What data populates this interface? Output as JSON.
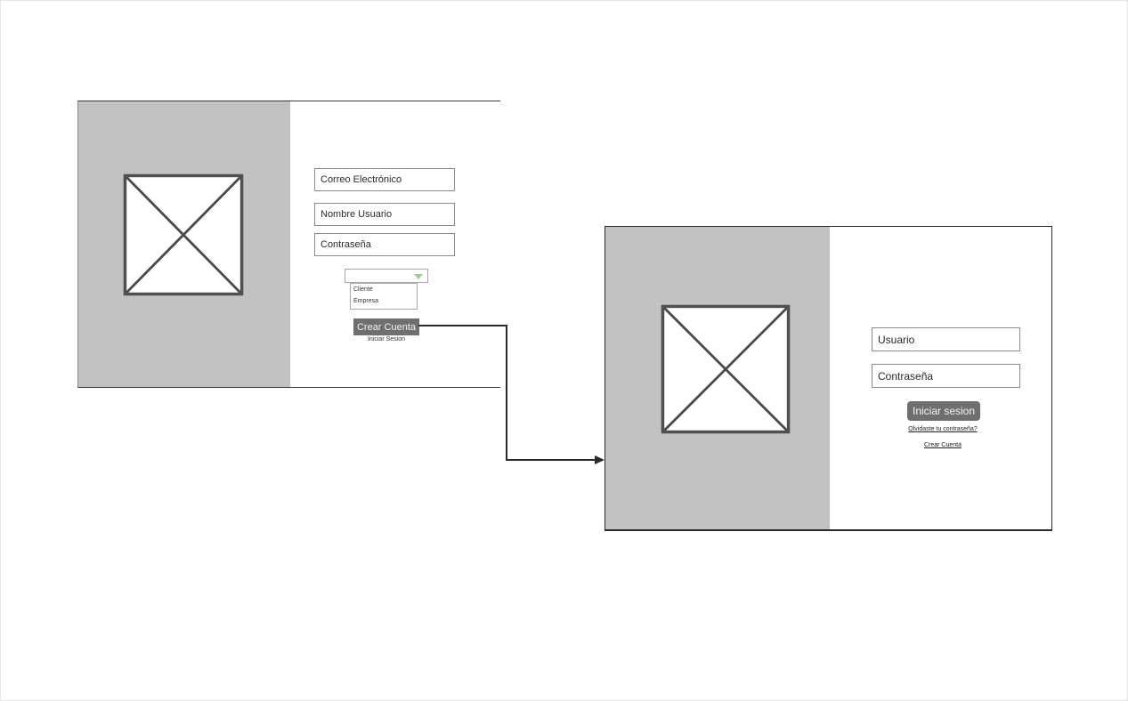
{
  "signup_screen": {
    "email_placeholder": "Correo Electrónico",
    "username_placeholder": "Nombre Usuario",
    "password_placeholder": "Contraseña",
    "account_type_options": [
      "Cliente",
      "Empresa"
    ],
    "create_account_button": "Crear Cuenta",
    "login_link": "Iniciar Sesion"
  },
  "login_screen": {
    "username_placeholder": "Usuario",
    "password_placeholder": "Contraseña",
    "login_button": "Iniciar sesion",
    "forgot_password_link": "Olvidaste tu contraseña?",
    "create_account_link": "Crear Cuenta"
  },
  "colors": {
    "panel_gray": "#c2c2c2",
    "button_gray": "#6f6f6f",
    "dropdown_arrow": "#9ccc8c"
  }
}
